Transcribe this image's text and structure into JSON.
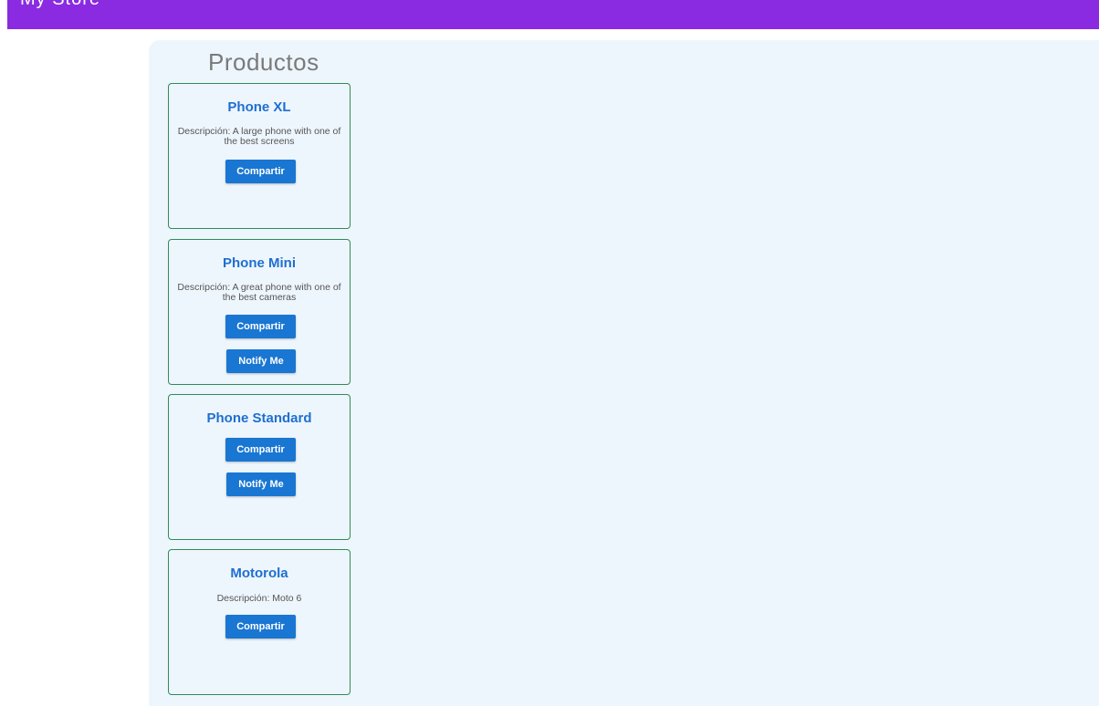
{
  "header": {
    "title": "My Store",
    "color": "#8a2be2"
  },
  "products_title": "Productos",
  "products": [
    {
      "name": "Phone XL",
      "description": "Descripción: A large phone with one of the best screens",
      "share_label": "Compartir",
      "notify_label": ""
    },
    {
      "name": "Phone Mini",
      "description": "Descripción: A great phone with one of the best cameras",
      "share_label": "Compartir",
      "notify_label": "Notify Me"
    },
    {
      "name": "Phone Standard",
      "description": "",
      "share_label": "Compartir",
      "notify_label": "Notify Me"
    },
    {
      "name": "Motorola",
      "description": "Descripción: Moto 6",
      "share_label": "Compartir",
      "notify_label": ""
    }
  ],
  "colors": {
    "accent": "#1976d2",
    "card_border": "#2e8b57",
    "panel_bg": "#eef6fd"
  }
}
